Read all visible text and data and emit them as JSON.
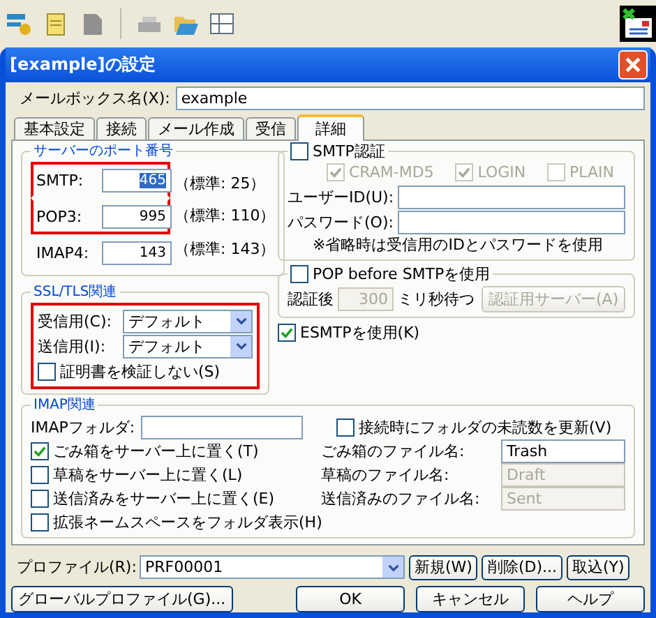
{
  "window": {
    "title": "[example]の設定"
  },
  "mailbox": {
    "label": "メールボックス名(X):",
    "value": "example"
  },
  "tabs": [
    {
      "label": "基本設定",
      "selected": false
    },
    {
      "label": "接続",
      "selected": false
    },
    {
      "label": "メール作成",
      "selected": false
    },
    {
      "label": "受信",
      "selected": false
    },
    {
      "label": "詳細",
      "selected": true
    }
  ],
  "ports": {
    "title": "サーバーのポート番号",
    "rows": [
      {
        "label": "SMTP:",
        "value": "465",
        "standard": "（標準: 25）",
        "highlighted": true,
        "value_selected": true
      },
      {
        "label": "POP3:",
        "value": "995",
        "standard": "（標準: 110）",
        "highlighted": true,
        "value_selected": false
      },
      {
        "label": "IMAP4:",
        "value": "143",
        "standard": "（標準: 143）",
        "highlighted": false,
        "value_selected": false
      }
    ]
  },
  "ssl": {
    "title": "SSL/TLS関連",
    "highlighted": true,
    "selects": [
      {
        "label": "受信用(C):",
        "value": "デフォルト"
      },
      {
        "label": "送信用(I):",
        "value": "デフォルト"
      }
    ],
    "no_verify": {
      "label": "証明書を検証しない(S)",
      "checked": false
    }
  },
  "smtp_auth": {
    "label": "SMTP認証",
    "checked": false,
    "methods": [
      {
        "label": "CRAM-MD5",
        "checked": true,
        "disabled": true
      },
      {
        "label": "LOGIN",
        "checked": true,
        "disabled": true
      },
      {
        "label": "PLAIN",
        "checked": false,
        "disabled": true
      }
    ],
    "fields": [
      {
        "label": "ユーザーID(U):"
      },
      {
        "label": "パスワード(O):"
      }
    ],
    "note": "※省略時は受信用のIDとパスワードを使用"
  },
  "pop_before": {
    "label": "POP before SMTPを使用",
    "checked": false,
    "wait_label": "認証後",
    "wait_value": "300",
    "disabled": true,
    "unit": "ミリ秒待つ",
    "server_button": "認証用サーバー(A)"
  },
  "esmtp": {
    "label": "ESMTPを使用(K)",
    "checked": true
  },
  "imap": {
    "title": "IMAP関連",
    "folder_label": "IMAPフォルダ:",
    "update_unread": {
      "label": "接続時にフォルダの未読数を更新(V)",
      "checked": false
    },
    "rows": [
      {
        "label": "ごみ箱をサーバー上に置く(T)",
        "checked": true,
        "file_label": "ごみ箱のファイル名:",
        "file_value": "Trash",
        "disabled": false
      },
      {
        "label": "草稿をサーバー上に置く(L)",
        "checked": false,
        "file_label": "草稿のファイル名:",
        "file_value": "Draft",
        "disabled": true
      },
      {
        "label": "送信済みをサーバー上に置く(E)",
        "checked": false,
        "file_label": "送信済みのファイル名:",
        "file_value": "Sent",
        "disabled": true
      }
    ],
    "namespace": {
      "label": "拡張ネームスペースをフォルダ表示(H)",
      "checked": false
    }
  },
  "profile": {
    "label": "プロファイル(R):",
    "value": "PRF00001",
    "buttons": [
      "新規(W)",
      "削除(D)...",
      "取込(Y)"
    ]
  },
  "buttons": [
    "グローバルプロファイル(G)...",
    "OK",
    "キャンセル",
    "ヘルプ"
  ]
}
